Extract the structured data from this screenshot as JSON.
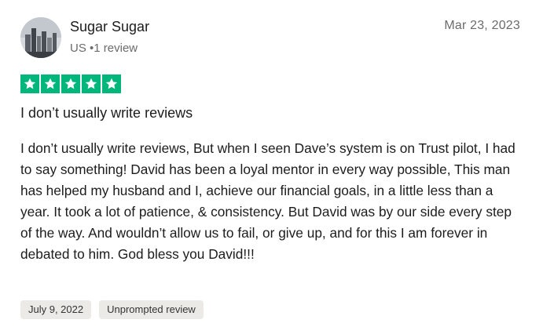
{
  "reviewer": {
    "name": "Sugar Sugar",
    "country": "US",
    "separator": "•",
    "review_count": "1 review",
    "avatar_icon": "profile-photo-city-skyline"
  },
  "review": {
    "date": "Mar 23, 2023",
    "rating": 5,
    "max_rating": 5,
    "star_color": "#00b67a",
    "title": "I don’t usually write reviews",
    "body": "I don’t usually write reviews, But when I seen Dave’s system is on Trust pilot, I had to say something! David has been a loyal mentor in every way possible, This man has helped my husband and I, achieve our financial goals, in a little less than a year. It took a lot of patience, & consistency. But David was by our side every step of the way. And wouldn’t allow us to fail, or give up, and for this I am forever in debated to him. God bless you David!!!",
    "experience_date": "July 9, 2022",
    "review_type": "Unprompted review"
  }
}
